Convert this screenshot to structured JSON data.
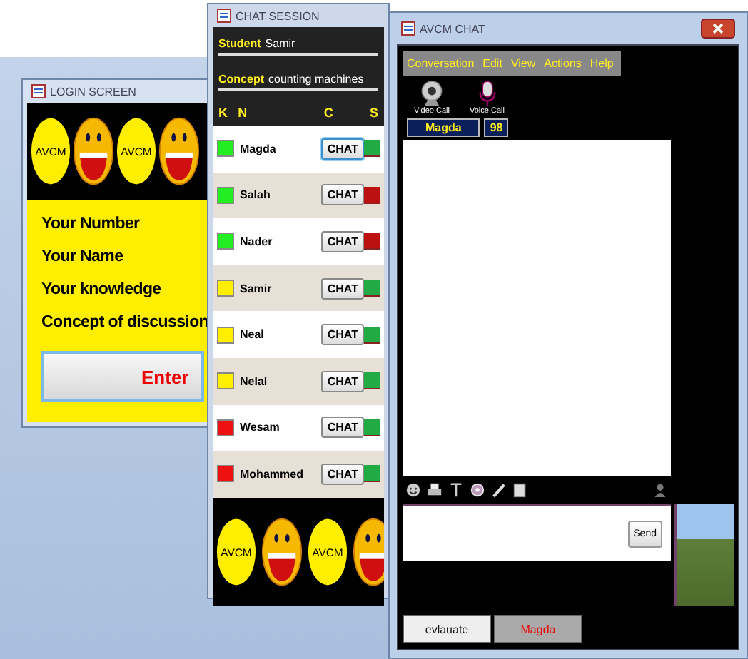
{
  "login_window": {
    "title": "LOGIN SCREEN",
    "banner": [
      {
        "kind": "badge",
        "text": "AVCM"
      },
      {
        "kind": "smiley"
      },
      {
        "kind": "badge",
        "text": "AVCM"
      },
      {
        "kind": "smiley"
      }
    ],
    "labels": [
      "Your Number",
      "Your Name",
      "Your knowledge",
      "Concept of discussion"
    ],
    "button": "Enter"
  },
  "session_window": {
    "title": "CHAT SESSION",
    "student_label": "Student",
    "student": "Samir",
    "concept_label": "Concept",
    "concept": "counting machines",
    "columns": [
      "K",
      "N",
      "C",
      "S"
    ],
    "rows": [
      {
        "color": "#22ee22",
        "name": "Magda",
        "button": "CHAT",
        "focused": true,
        "s": {
          "color": "#22aa44"
        }
      },
      {
        "color": "#22ee22",
        "name": "Salah",
        "button": "CHAT",
        "focused": false,
        "s": {
          "color": "#bb1111"
        }
      },
      {
        "color": "#22ee22",
        "name": "Nader",
        "button": "CHAT",
        "focused": false,
        "s": {
          "color": "#bb1111"
        }
      },
      {
        "color": "#ffee00",
        "name": "Samir",
        "button": "CHAT",
        "focused": false,
        "s": {
          "color": "#22aa44"
        }
      },
      {
        "color": "#ffee00",
        "name": "Neal",
        "button": "CHAT",
        "focused": false,
        "s": {
          "color": "#22aa44"
        }
      },
      {
        "color": "#ffee00",
        "name": "Nelal",
        "button": "CHAT",
        "focused": false,
        "s": {
          "color": "#22aa44"
        }
      },
      {
        "color": "#ee1111",
        "name": "Wesam",
        "button": "CHAT",
        "focused": false,
        "s": {
          "color": "#22aa44"
        }
      },
      {
        "color": "#ee1111",
        "name": "Mohammed",
        "button": "CHAT",
        "focused": false,
        "s": {
          "color": "#22aa44"
        }
      }
    ],
    "banner": [
      {
        "kind": "badge",
        "text": "AVCM"
      },
      {
        "kind": "smiley"
      },
      {
        "kind": "badge",
        "text": "AVCM"
      },
      {
        "kind": "smiley"
      }
    ]
  },
  "chat_window": {
    "title": "AVCM CHAT",
    "menu": [
      "Conversation",
      "Edit",
      "View",
      "Actions",
      "Help"
    ],
    "calls": [
      {
        "kind": "video",
        "label": "Video Call"
      },
      {
        "kind": "voice",
        "label": "Voice Call"
      }
    ],
    "contact": "Magda",
    "number": "98",
    "send_button": "Send",
    "tabs": [
      {
        "label": "evlauate",
        "selected": true
      },
      {
        "label": "Magda",
        "selected": false
      }
    ]
  }
}
